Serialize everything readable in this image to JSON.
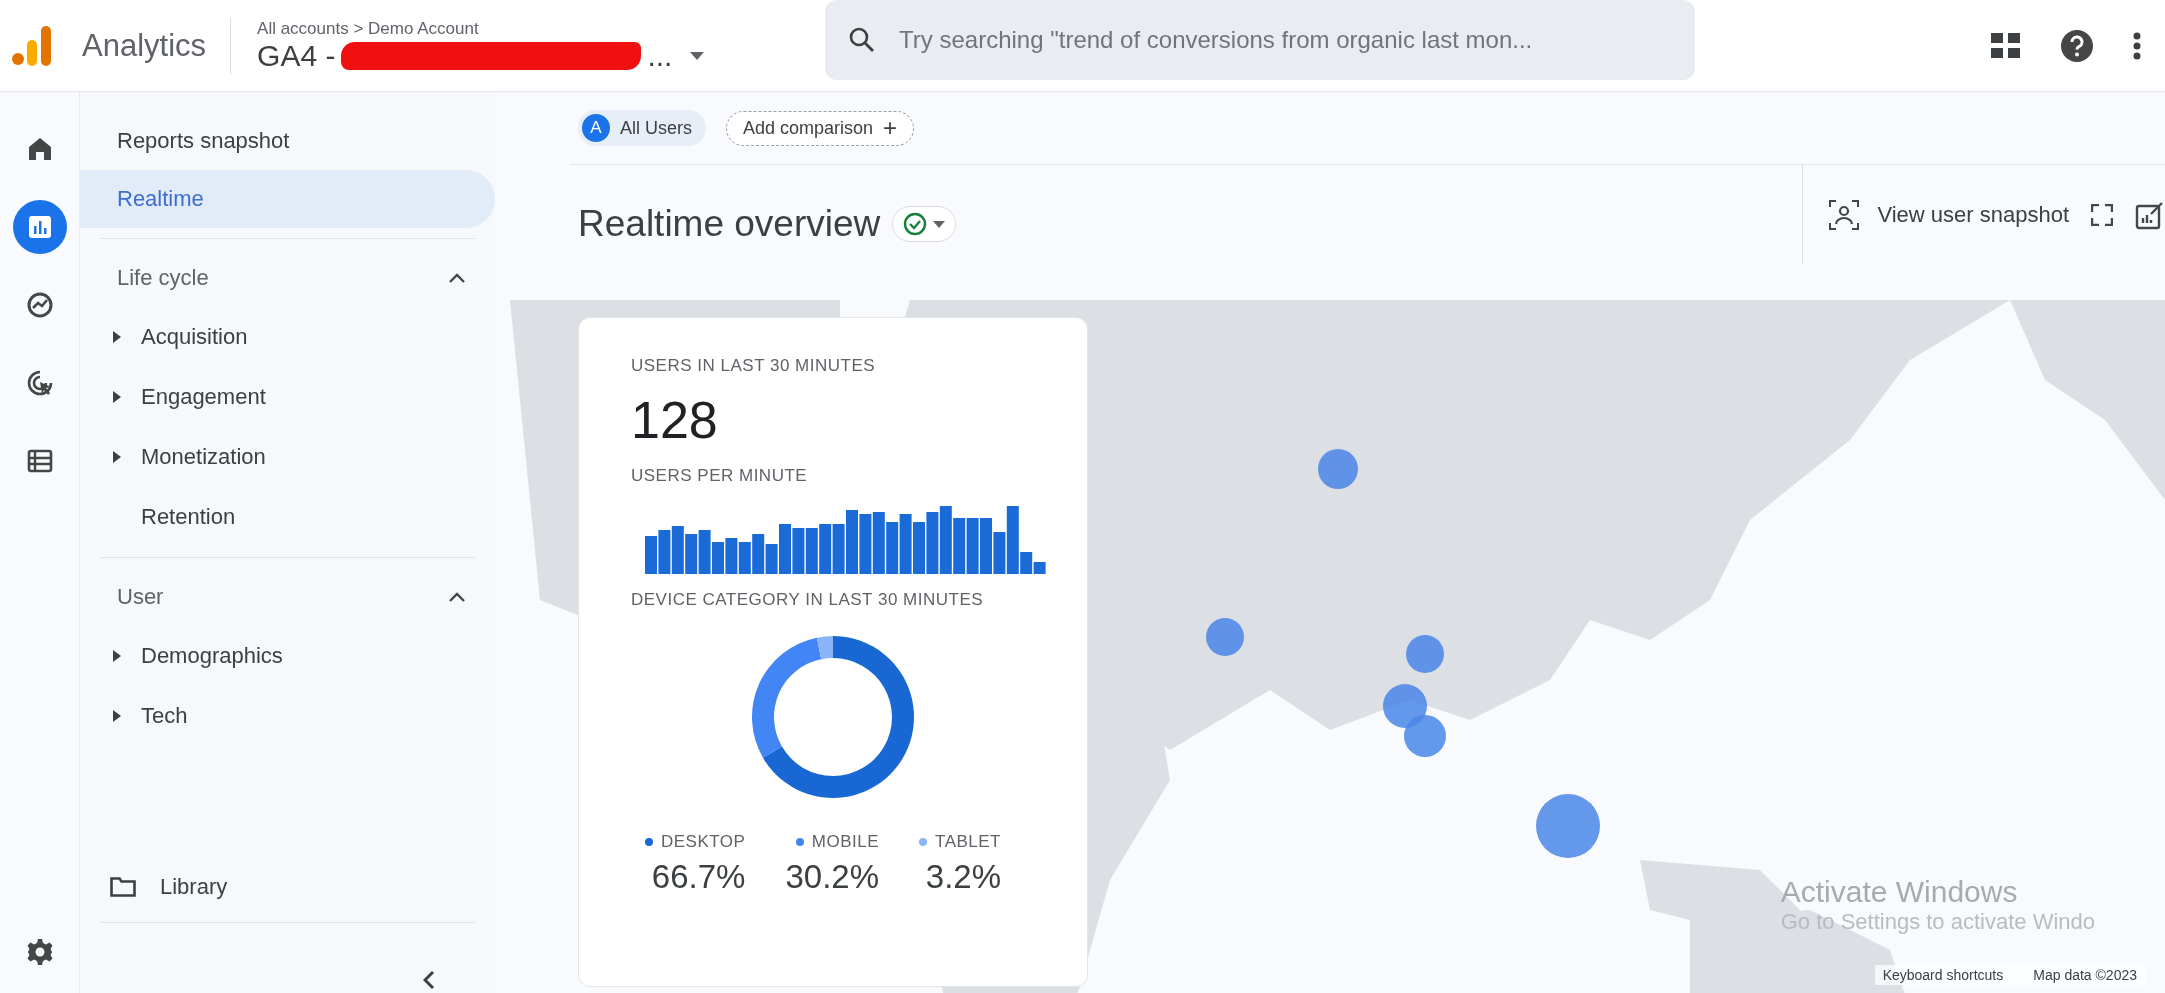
{
  "app": {
    "name": "Analytics"
  },
  "breadcrumb": "All accounts > Demo Account",
  "property": {
    "prefix": "GA4 -",
    "suffix": "..."
  },
  "search": {
    "placeholder": "Try searching \"trend of conversions from organic last mon..."
  },
  "rail": [
    {
      "kind": "home",
      "selected": false
    },
    {
      "kind": "reports",
      "selected": true
    },
    {
      "kind": "explore",
      "selected": false
    },
    {
      "kind": "advertising",
      "selected": false
    },
    {
      "kind": "configure",
      "selected": false
    }
  ],
  "nav": [
    {
      "kind": "link",
      "label": "Reports snapshot",
      "selected": false
    },
    {
      "kind": "link",
      "label": "Realtime",
      "selected": true
    },
    {
      "kind": "section",
      "label": "Life cycle",
      "expanded": true,
      "children": [
        {
          "kind": "folder",
          "label": "Acquisition"
        },
        {
          "kind": "folder",
          "label": "Engagement"
        },
        {
          "kind": "folder",
          "label": "Monetization"
        },
        {
          "kind": "page",
          "label": "Retention"
        }
      ]
    },
    {
      "kind": "section",
      "label": "User",
      "expanded": true,
      "children": [
        {
          "kind": "folder",
          "label": "Demographics"
        },
        {
          "kind": "folder",
          "label": "Tech"
        }
      ]
    }
  ],
  "library": {
    "label": "Library"
  },
  "comparison": {
    "badge": "A",
    "segment": "All Users",
    "add_label": "Add comparison",
    "add_icon": "+"
  },
  "title": "Realtime overview",
  "toolbar": {
    "snapshot": "View user snapshot"
  },
  "card": {
    "users_title": "USERS IN LAST 30 MINUTES",
    "users_value": "128",
    "per_minute_title": "USERS PER MINUTE",
    "device_title": "DEVICE CATEGORY IN LAST 30 MINUTES",
    "legend": [
      {
        "value": "66.7%",
        "color": "#1967d2"
      },
      {
        "value": "30.2%",
        "color": "#4285f4"
      },
      {
        "value": "3.2%",
        "color": "#8ab4f8"
      }
    ],
    "chart_data": {
      "type": "donut",
      "categories": [
        "DESKTOP",
        "MOBILE",
        "TABLET"
      ],
      "series": [
        {
          "values": [
            66.7,
            30.2,
            3.2
          ]
        }
      ]
    }
  },
  "map_footer": [
    "Keyboard shortcuts",
    "Map data ©2023"
  ],
  "os_notice": {
    "title": "Activate Windows",
    "subtitle": "Go to Settings to activate Windo"
  }
}
